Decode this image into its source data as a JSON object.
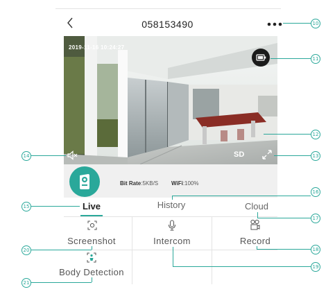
{
  "header": {
    "title": "058153490",
    "back_glyph": "<",
    "more_glyph": "•••"
  },
  "video": {
    "timestamp": "2019-11-16 10:24:27",
    "quality_label": "SD"
  },
  "status": {
    "bitrate_label": "Bit Rate",
    "bitrate_value": ":5KB/S",
    "wifi_label": "WiFi",
    "wifi_value": ":100%"
  },
  "tabs": [
    {
      "label": "Live",
      "active": true
    },
    {
      "label": "History",
      "active": false
    },
    {
      "label": "Cloud",
      "active": false
    }
  ],
  "functions": [
    {
      "label": "Screenshot",
      "icon": "screenshot-icon"
    },
    {
      "label": "Intercom",
      "icon": "microphone-icon"
    },
    {
      "label": "Record",
      "icon": "record-icon"
    },
    {
      "label": "Body Detection",
      "icon": "body-detection-icon"
    }
  ],
  "callouts": [
    "10",
    "11",
    "12",
    "13",
    "14",
    "15",
    "16",
    "17",
    "18",
    "19",
    "20",
    "21"
  ],
  "colors": {
    "accent": "#2aa89a",
    "divider": "#e3e3e3"
  }
}
